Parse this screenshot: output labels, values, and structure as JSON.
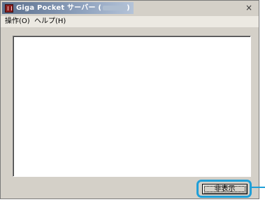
{
  "window": {
    "title": "Giga Pocket サーバー (",
    "title_suffix": ")",
    "close_glyph": "×"
  },
  "menu": {
    "items": [
      {
        "label": "操作(O)"
      },
      {
        "label": "ヘルプ(H)"
      }
    ]
  },
  "footer": {
    "hide_button_label": "非表示"
  },
  "colors": {
    "titlebar_start": "#5b6f8c",
    "titlebar_end": "#b4c3d8",
    "window_bg": "#d4d0c8",
    "highlight": "#1f9fd8"
  },
  "icons": {
    "app": "giga-pocket-app-icon",
    "close": "close-icon"
  }
}
